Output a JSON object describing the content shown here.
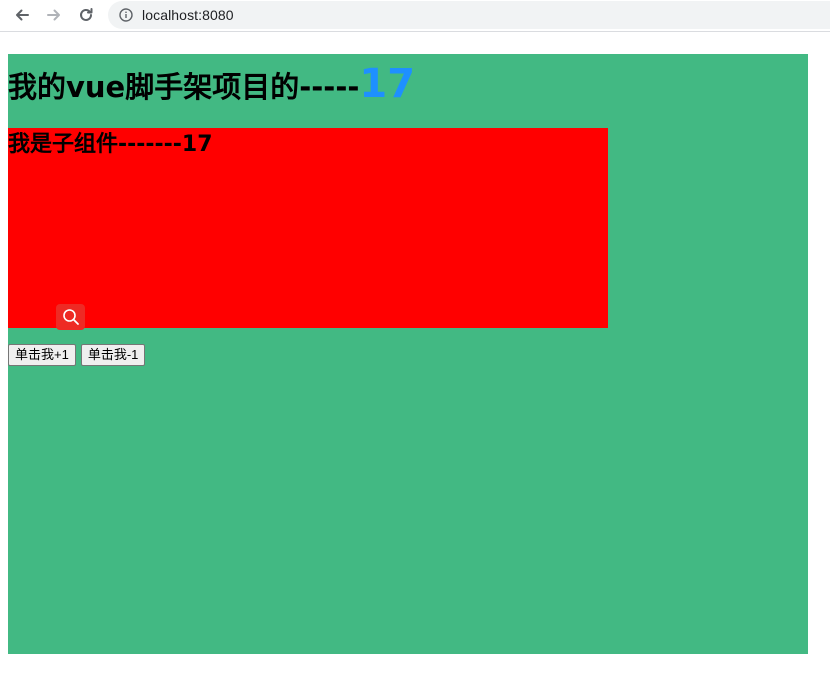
{
  "browser": {
    "url": "localhost:8080",
    "icons": {
      "back": "arrow-left-icon",
      "forward": "arrow-right-icon",
      "reload": "reload-icon",
      "info": "info-icon"
    }
  },
  "app": {
    "title_prefix": "我的vue脚手架项目的-----",
    "count": "17",
    "background": "#42b983",
    "count_color": "#1e90ff"
  },
  "child": {
    "title": "我是子组件-------17",
    "background": "#ff0000",
    "search_icon": "search-icon"
  },
  "buttons": {
    "increment_label": "单击我+1",
    "decrement_label": "单击我-1"
  }
}
